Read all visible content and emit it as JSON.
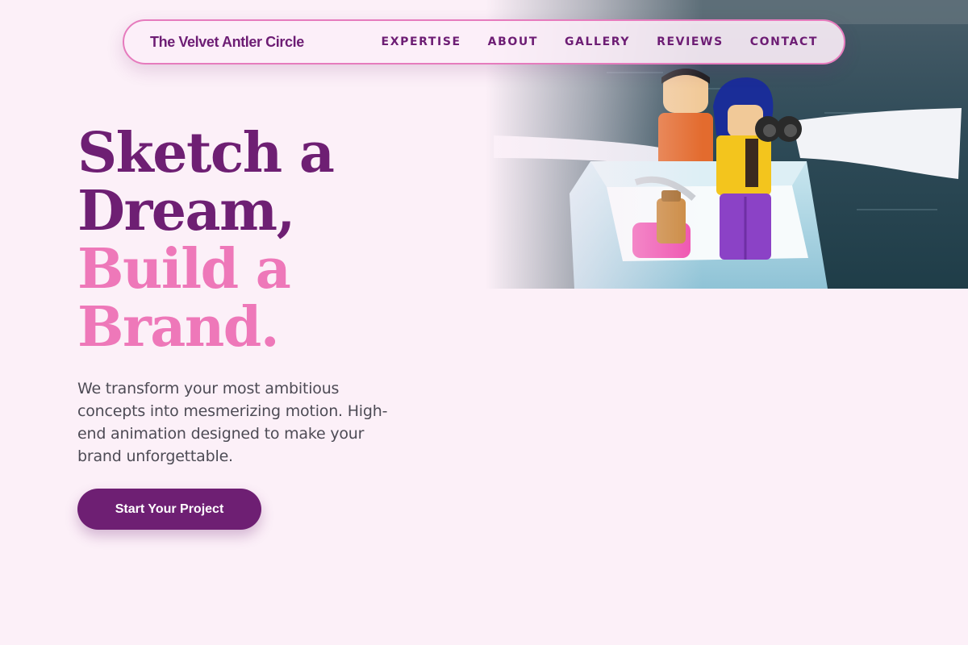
{
  "brand": {
    "name": "The Velvet Antler Circle"
  },
  "nav": {
    "items": [
      {
        "label": "EXPERTISE"
      },
      {
        "label": "ABOUT"
      },
      {
        "label": "GALLERY"
      },
      {
        "label": "REVIEWS"
      },
      {
        "label": "CONTACT"
      }
    ]
  },
  "hero": {
    "title_lines": [
      "Sketch a",
      "Dream,",
      "Build a",
      "Brand."
    ],
    "description": "We transform your most ambitious concepts into mesmerizing motion. High-end animation designed to make your brand unforgettable.",
    "cta_label": "Start Your Project",
    "image_description": "Toy figures in a paper boat on water"
  },
  "colors": {
    "background": "#fcf0f8",
    "brand_purple": "#6e1f73",
    "accent_pink": "#ee78b9",
    "body_text": "#4d4b55",
    "nav_border": "#e67bbd"
  }
}
